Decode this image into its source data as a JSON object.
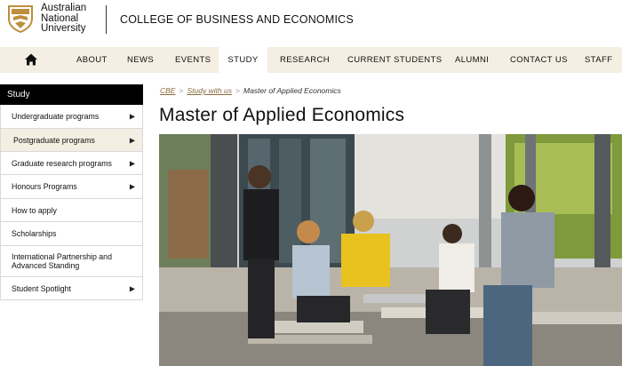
{
  "header": {
    "university_name": [
      "Australian",
      "National",
      "University"
    ],
    "college_name": "COLLEGE OF BUSINESS AND ECONOMICS"
  },
  "nav": {
    "items": [
      {
        "label": "ABOUT"
      },
      {
        "label": "NEWS"
      },
      {
        "label": "EVENTS"
      },
      {
        "label": "STUDY"
      },
      {
        "label": "RESEARCH"
      },
      {
        "label": "CURRENT STUDENTS"
      },
      {
        "label": "ALUMNI"
      },
      {
        "label": "CONTACT US"
      },
      {
        "label": "STAFF"
      }
    ],
    "active": "STUDY"
  },
  "sidebar": {
    "heading": "Study",
    "items": [
      {
        "label": "Undergraduate programs",
        "has_arrow": true
      },
      {
        "label": "Postgraduate programs",
        "has_arrow": true,
        "active": true
      },
      {
        "label": "Graduate research programs",
        "has_arrow": true
      },
      {
        "label": "Honours Programs",
        "has_arrow": true
      },
      {
        "label": "How to apply",
        "has_arrow": false
      },
      {
        "label": "Scholarships",
        "has_arrow": false
      },
      {
        "label": "International Partnership and Advanced Standing",
        "has_arrow": false
      },
      {
        "label": "Student Spotlight",
        "has_arrow": true
      }
    ],
    "arrow_glyph": "▶"
  },
  "breadcrumb": {
    "items": [
      "CBE",
      "Study with us"
    ],
    "separator": ">",
    "current": "Master of Applied Economics"
  },
  "page_title": "Master of Applied Economics",
  "colors": {
    "nav_bg": "#f5eee2",
    "brand_gold": "#be8e3c",
    "sidebar_head_bg": "#000000",
    "link": "#8a6a3e"
  }
}
